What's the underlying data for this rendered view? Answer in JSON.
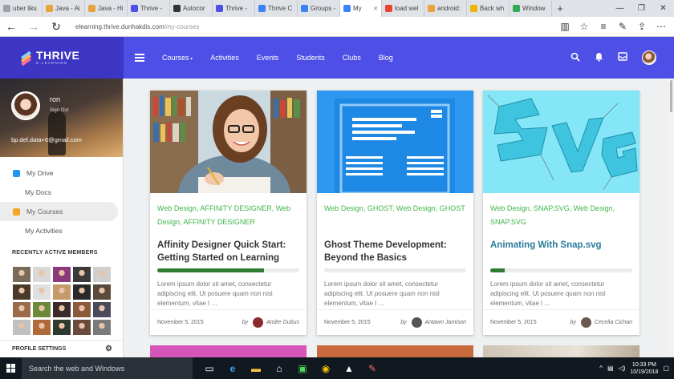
{
  "browser": {
    "tabs": [
      {
        "label": "uber liks",
        "color": "#9aa0a6"
      },
      {
        "label": "Java - Ai",
        "color": "#e8a33d"
      },
      {
        "label": "Java - Hi",
        "color": "#e8a33d"
      },
      {
        "label": "Thrive -",
        "color": "#4d4fe6"
      },
      {
        "label": "Autocor",
        "color": "#333333"
      },
      {
        "label": "Thrive -",
        "color": "#4d4fe6"
      },
      {
        "label": "Thrive C",
        "color": "#3b82f6"
      },
      {
        "label": "Groups -",
        "color": "#3b82f6"
      },
      {
        "label": "My",
        "color": "#3b82f6",
        "active": true
      },
      {
        "label": "load wel",
        "color": "#ea4335"
      },
      {
        "label": "android:",
        "color": "#e8a33d"
      },
      {
        "label": "Back wh",
        "color": "#f0b400"
      },
      {
        "label": "Window",
        "color": "#34a853"
      }
    ],
    "new_tab": "+",
    "url_domain": "elearning.thrive.dunhakdis.com",
    "url_path": "/my-courses",
    "win_controls": [
      "—",
      "❐",
      "✕"
    ]
  },
  "brand": {
    "name": "THRIVE",
    "sub": "E-LEARNING"
  },
  "nav": {
    "links": [
      "Courses",
      "Activities",
      "Events",
      "Students",
      "Clubs",
      "Blog"
    ]
  },
  "user": {
    "name": "ron",
    "signout": "Sign Out",
    "email": "bp.def.data+6@gmail.com"
  },
  "sidebar": {
    "items": [
      {
        "label": "My Drive",
        "icon_color": "#2196f3",
        "active": false
      },
      {
        "label": "My Docs",
        "active": false
      },
      {
        "label": "My Courses",
        "icon_color": "#f5a623",
        "active": true
      },
      {
        "label": "My Activities",
        "active": false
      }
    ],
    "members_title": "RECENTLY ACTIVE MEMBERS",
    "profile_settings": "PROFILE SETTINGS"
  },
  "courses": [
    {
      "tags": "Web Design, AFFINITY DESIGNER, Web Design, AFFINITY DESIGNER",
      "title": "Affinity Designer Quick Start: Getting Started on Learning",
      "progress": 0.75,
      "excerpt": "Lorem ipsum dolor sit amet, consectetur adipiscing elit. Ut posuere quam non nisl elementum, vitae l …",
      "date": "November 5, 2015",
      "by": "by",
      "author": "Andre Dubus",
      "author_color": "#8a2b2b"
    },
    {
      "tags": "Web Design, GHOST, Web Design, GHOST",
      "title": "Ghost Theme Development: Beyond the Basics",
      "progress": 0,
      "excerpt": "Lorem ipsum dolor sit amet, consectetur adipiscing elit. Ut posuere quam non nisl elementum, vitae l …",
      "date": "November 5, 2015",
      "by": "by",
      "author": "Antawn Jamison",
      "author_color": "#555555"
    },
    {
      "tags": "Web Design, SNAP.SVG, Web Design, SNAP.SVG",
      "title": "Animating With Snap.svg",
      "progress": 0.1,
      "excerpt": "Lorem ipsum dolor sit amet, consectetur adipiscing elit. Ut posuere quam non nisl elementum, vitae l …",
      "date": "November 5, 2015",
      "by": "by",
      "author": "Cecelia Cichan",
      "author_color": "#6b5a4f"
    }
  ],
  "taskbar": {
    "search_placeholder": "Search the web and Windows",
    "time": "10:33 PM",
    "date": "10/19/2018"
  }
}
